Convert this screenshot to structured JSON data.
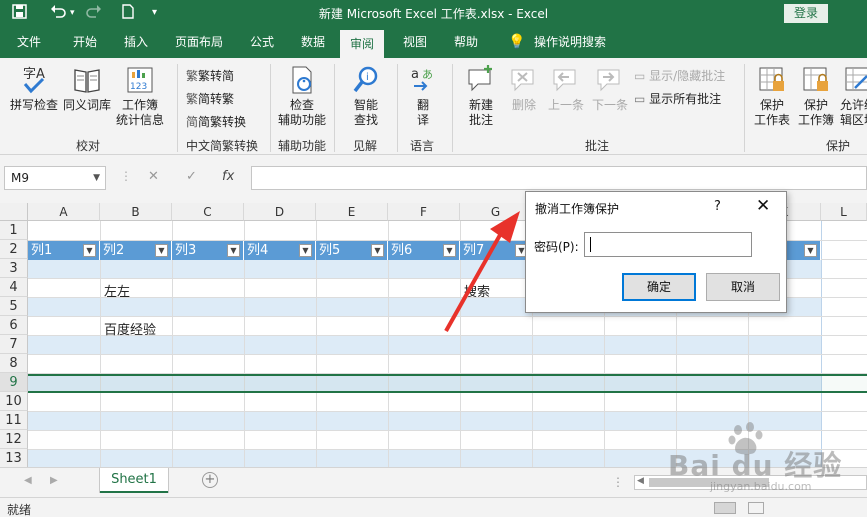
{
  "titlebar": {
    "title": "新建 Microsoft Excel 工作表.xlsx  -  Excel",
    "login": "登录",
    "quick_access": [
      "save-icon",
      "undo-icon",
      "redo-icon",
      "new-file-icon",
      "customize-icon"
    ]
  },
  "menu": {
    "tabs": [
      "文件",
      "开始",
      "插入",
      "页面布局",
      "公式",
      "数据",
      "审阅",
      "视图",
      "帮助"
    ],
    "active": "审阅",
    "search": "操作说明搜索"
  },
  "ribbon": {
    "proofing": {
      "label": "校对",
      "spell": "拼写检查",
      "thesaurus": "同义词库",
      "stats_1": "工作簿",
      "stats_2": "统计信息"
    },
    "chinese": {
      "label": "中文简繁转换",
      "to_simplified": "繁转简",
      "to_traditional": "简转繁",
      "convert": "简繁转换"
    },
    "accessibility": {
      "label": "辅助功能",
      "check_1": "检查",
      "check_2": "辅助功能"
    },
    "insights": {
      "label": "见解",
      "smart_1": "智能",
      "smart_2": "查找"
    },
    "language": {
      "label": "语言",
      "translate_1": "翻",
      "translate_2": "译"
    },
    "comments": {
      "label": "批注",
      "new_1": "新建",
      "new_2": "批注",
      "delete": "删除",
      "prev": "上一条",
      "next": "下一条",
      "show_hide": "显示/隐藏批注",
      "show_all": "显示所有批注"
    },
    "protect": {
      "label": "保护",
      "sheet_1": "保护",
      "sheet_2": "工作表",
      "workbook_1": "保护",
      "workbook_2": "工作簿",
      "allow_1": "允许编",
      "allow_2": "辑区域"
    }
  },
  "formula_bar": {
    "name_box": "M9",
    "fx": "fx"
  },
  "sheet": {
    "columns": [
      "A",
      "B",
      "C",
      "D",
      "E",
      "F",
      "G",
      "H",
      "I",
      "J",
      "K",
      "L"
    ],
    "rows": [
      "1",
      "2",
      "3",
      "4",
      "5",
      "6",
      "7",
      "8",
      "9",
      "10",
      "11",
      "12",
      "13"
    ],
    "selected_row": "9",
    "table_headers": [
      "列1",
      "列2",
      "列3",
      "列4",
      "列5",
      "列6",
      "列7"
    ],
    "cells": {
      "b4": "左左",
      "b6": "百度经验",
      "g4": "搜索"
    }
  },
  "tabs": {
    "sheet1": "Sheet1",
    "add": "+"
  },
  "status": {
    "text": "就绪"
  },
  "dialog": {
    "title": "撤消工作簿保护",
    "help": "?",
    "close": "✕",
    "password_label": "密码(P):",
    "password_value": "",
    "ok": "确定",
    "cancel": "取消"
  },
  "watermark": {
    "brand": "Bai du 经验",
    "url": "jingyan.baidu.com"
  },
  "colors": {
    "excel_green": "#217346",
    "table_header": "#5b9bd5",
    "table_band": "#ddebf7",
    "arrow": "#e8322b"
  }
}
